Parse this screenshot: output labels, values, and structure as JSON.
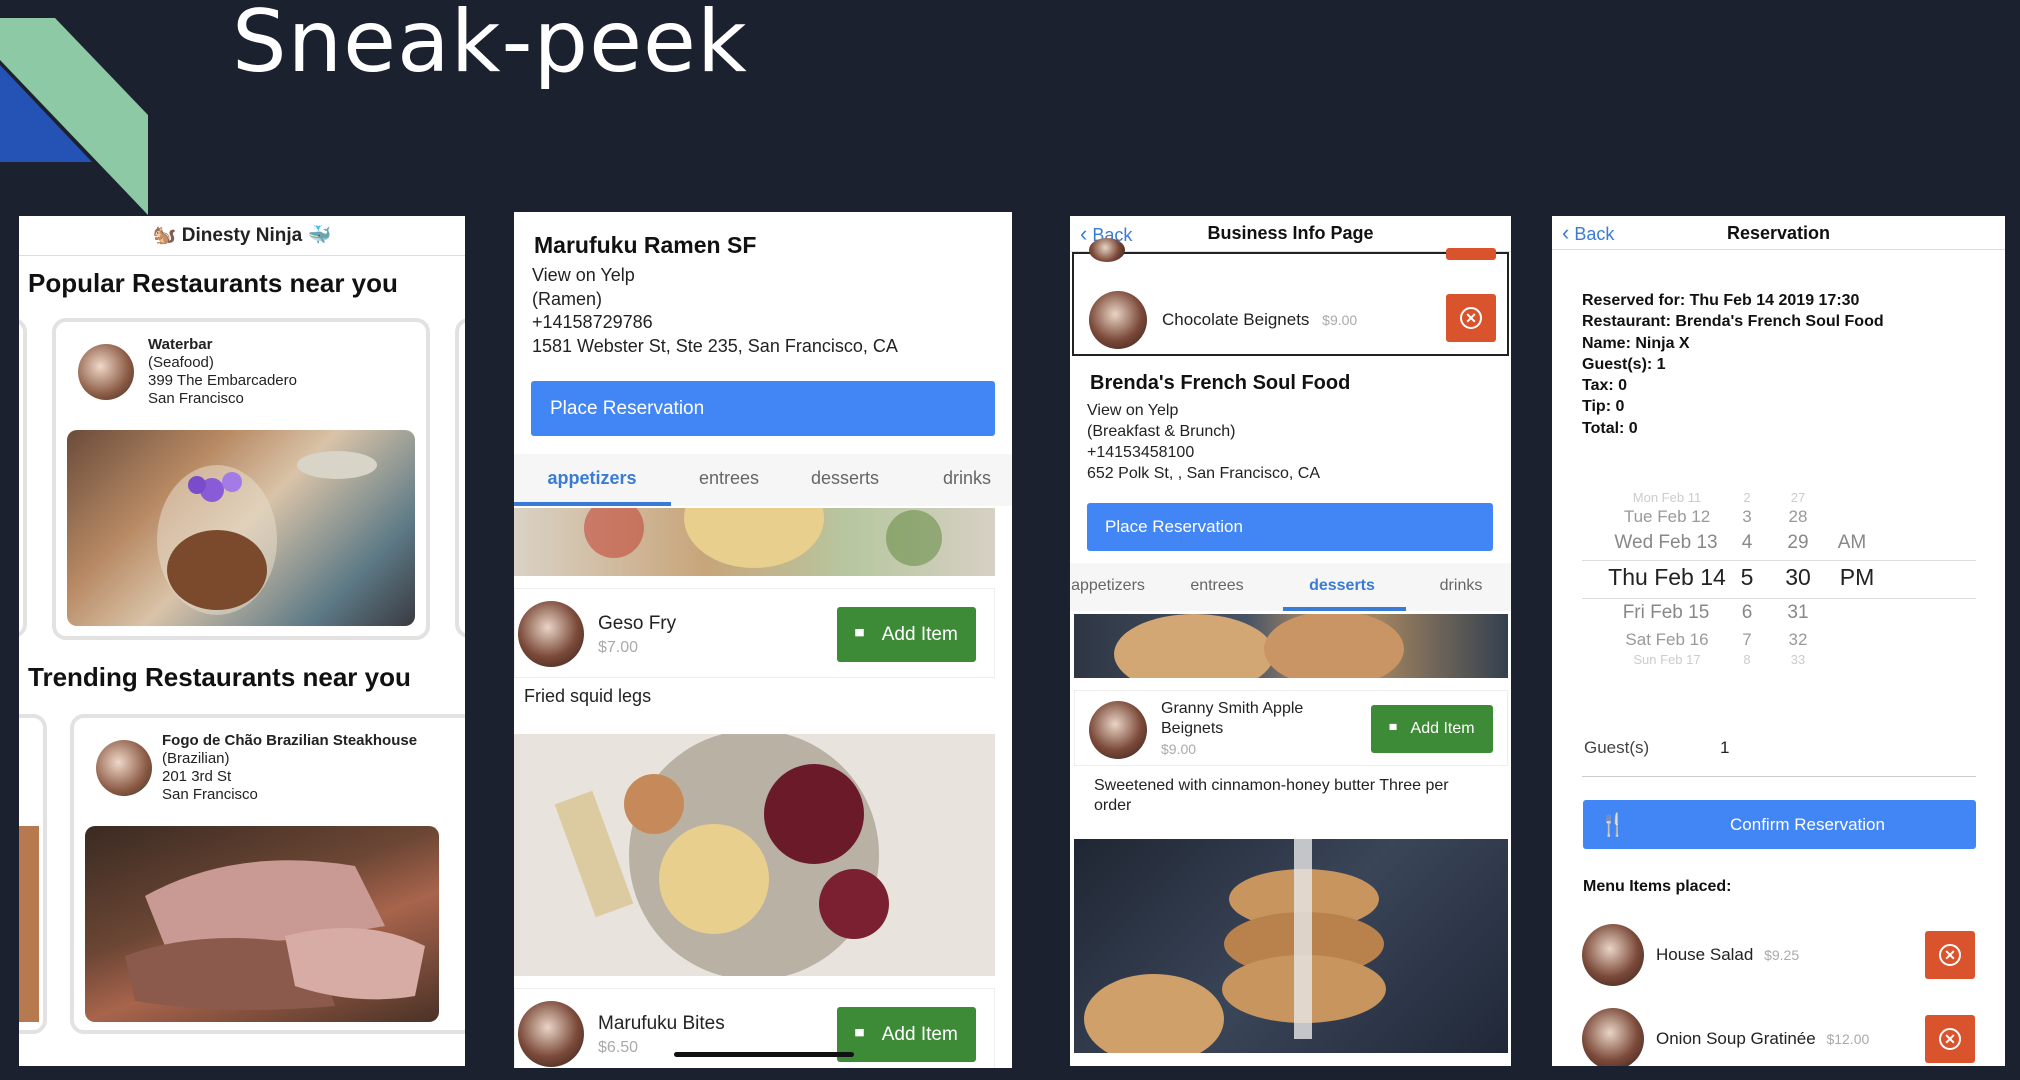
{
  "slide": {
    "title": "Sneak-peek"
  },
  "colors": {
    "background": "#1c2130",
    "accent_blue": "#4285f4",
    "green": "#3d8b37",
    "red": "#d9532c",
    "deco_green": "#8cc9a4",
    "deco_blue": "#2452b5"
  },
  "phone1": {
    "header": "🐿️ Dinesty Ninja 🐳",
    "popular_title": "Popular Restaurants near you",
    "trending_title": "Trending Restaurants near you",
    "card1": {
      "name": "Waterbar",
      "category": "(Seafood)",
      "address": "399 The Embarcadero",
      "city": "San Francisco"
    },
    "card2": {
      "name": "Fogo de Chão Brazilian Steakhouse",
      "category": "(Brazilian)",
      "address": "201 3rd St",
      "city": "San Francisco"
    }
  },
  "phone2": {
    "name": "Marufuku Ramen SF",
    "yelp": "View on Yelp",
    "category": "(Ramen)",
    "phone": "+14158729786",
    "address": "1581 Webster St, Ste 235, San Francisco, CA",
    "reserve_button": "Place Reservation",
    "tabs": [
      "appetizers",
      "entrees",
      "desserts",
      "drinks"
    ],
    "item1": {
      "name": "Geso Fry",
      "price": "$7.00",
      "desc": "Fried squid legs",
      "button": "Add Item"
    },
    "item2": {
      "name": "Marufuku Bites",
      "price": "$6.50",
      "button": "Add Item"
    }
  },
  "phone3": {
    "back": "Back",
    "title": "Business Info Page",
    "selected_item": {
      "name": "Chocolate Beignets",
      "price": "$9.00"
    },
    "name": "Brenda's French Soul Food",
    "yelp": "View on Yelp",
    "category": "(Breakfast & Brunch)",
    "phone": "+14153458100",
    "address": "652 Polk St, , San Francisco, CA",
    "reserve_button": "Place Reservation",
    "tabs": [
      "appetizers",
      "entrees",
      "desserts",
      "drinks"
    ],
    "item": {
      "name1": "Granny Smith Apple",
      "name2": "Beignets",
      "price": "$9.00",
      "desc1": "Sweetened with cinnamon-honey butter Three per",
      "desc2": "order",
      "button": "Add Item"
    }
  },
  "phone4": {
    "back": "Back",
    "title": "Reservation",
    "summary": [
      "Reserved for: Thu Feb 14 2019 17:30",
      "Restaurant: Brenda's French Soul Food",
      "Name: Ninja X",
      "Guest(s): 1",
      "Tax: 0",
      "Tip: 0",
      "Total: 0"
    ],
    "picker": {
      "rows": [
        {
          "d": "Mon Feb 11",
          "h": "2",
          "m": "27",
          "ap": ""
        },
        {
          "d": "Tue Feb 12",
          "h": "3",
          "m": "28",
          "ap": ""
        },
        {
          "d": "Wed Feb 13",
          "h": "4",
          "m": "29",
          "ap": "AM"
        },
        {
          "d": "Thu Feb 14",
          "h": "5",
          "m": "30",
          "ap": "PM"
        },
        {
          "d": "Fri Feb 15",
          "h": "6",
          "m": "31",
          "ap": ""
        },
        {
          "d": "Sat Feb 16",
          "h": "7",
          "m": "32",
          "ap": ""
        },
        {
          "d": "Sun Feb 17",
          "h": "8",
          "m": "33",
          "ap": ""
        }
      ]
    },
    "guests_label": "Guest(s)",
    "guests_value": "1",
    "confirm_button": "Confirm Reservation",
    "menu_title": "Menu Items placed:",
    "items": [
      {
        "name": "House Salad",
        "price": "$9.25"
      },
      {
        "name": "Onion Soup Gratinée",
        "price": "$12.00"
      }
    ]
  }
}
